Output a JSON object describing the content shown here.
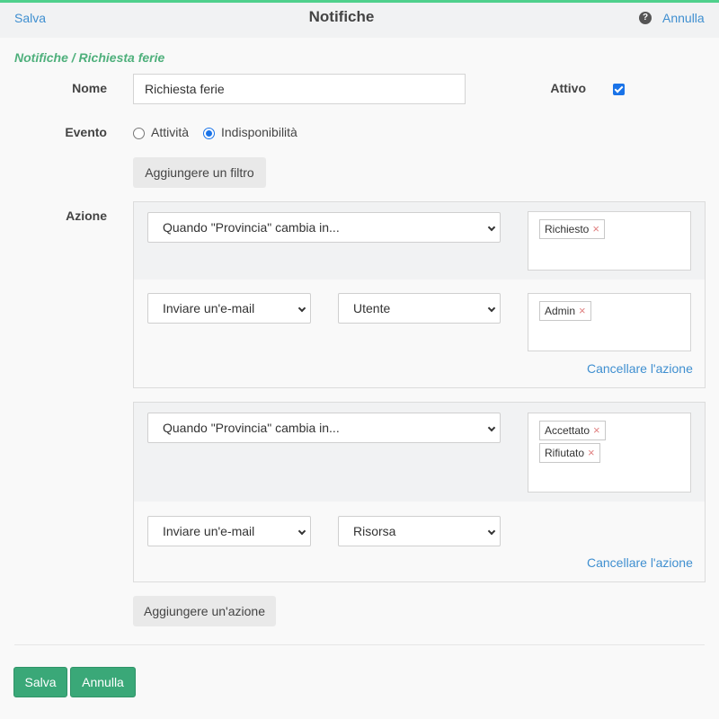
{
  "topbar": {
    "save_label": "Salva",
    "title": "Notifiche",
    "help_icon_glyph": "?",
    "cancel_label": "Annulla"
  },
  "breadcrumb": "Notifiche / Richiesta ferie",
  "form": {
    "name_label": "Nome",
    "name_value": "Richiesta ferie",
    "active_label": "Attivo",
    "active_checked": true,
    "event_label": "Evento",
    "event_options": [
      "Attività",
      "Indisponibilità"
    ],
    "event_selected": "Indisponibilità",
    "add_filter_label": "Aggiungere un filtro",
    "action_label": "Azione"
  },
  "actions": [
    {
      "condition": "Quando \"Provincia\" cambia in...",
      "condition_tags": [
        "Richiesto"
      ],
      "action_type": "Inviare un'e-mail",
      "recipient": "Utente",
      "recipient_tags": [
        "Admin"
      ],
      "delete_label": "Cancellare l'azione"
    },
    {
      "condition": "Quando \"Provincia\" cambia in...",
      "condition_tags": [
        "Accettato",
        "Rifiutato"
      ],
      "action_type": "Inviare un'e-mail",
      "recipient": "Risorsa",
      "recipient_tags": [],
      "delete_label": "Cancellare l'azione"
    }
  ],
  "add_action_label": "Aggiungere un'azione",
  "footer": {
    "save_label": "Salva",
    "cancel_label": "Annulla"
  },
  "tag_remove_glyph": "×",
  "colors": {
    "accent_green": "#3aa878",
    "top_border": "#4fd08c",
    "link_blue": "#3f8fd0",
    "breadcrumb_green": "#4fb07c",
    "checkbox_blue": "#1a73e8"
  }
}
